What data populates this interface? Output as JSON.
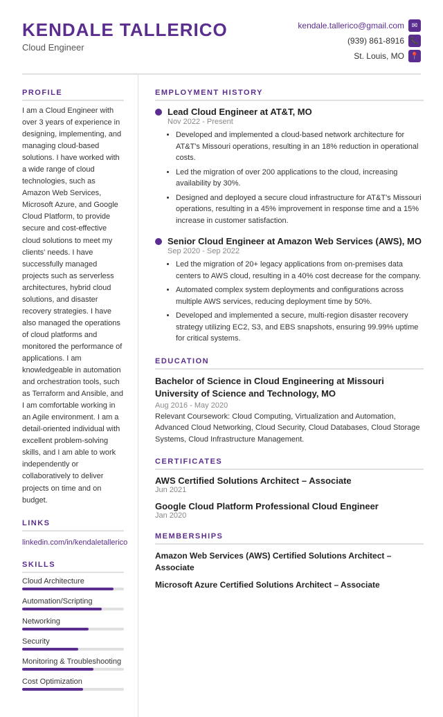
{
  "header": {
    "name": "KENDALE TALLERICO",
    "title": "Cloud Engineer",
    "email": "kendale.tallerico@gmail.com",
    "phone": "(939) 861-8916",
    "location": "St. Louis, MO"
  },
  "profile": {
    "section_title": "PROFILE",
    "text": "I am a Cloud Engineer with over 3 years of experience in designing, implementing, and managing cloud-based solutions. I have worked with a wide range of cloud technologies, such as Amazon Web Services, Microsoft Azure, and Google Cloud Platform, to provide secure and cost-effective cloud solutions to meet my clients' needs. I have successfully managed projects such as serverless architectures, hybrid cloud solutions, and disaster recovery strategies. I have also managed the operations of cloud platforms and monitored the performance of applications. I am knowledgeable in automation and orchestration tools, such as Terraform and Ansible, and I am comfortable working in an Agile environment. I am a detail-oriented individual with excellent problem-solving skills, and I am able to work independently or collaboratively to deliver projects on time and on budget."
  },
  "links": {
    "section_title": "LINKS",
    "linkedin": "linkedin.com/in/kendaletallerico"
  },
  "skills": {
    "section_title": "SKILLS",
    "items": [
      {
        "name": "Cloud Architecture",
        "pct": 90
      },
      {
        "name": "Automation/Scripting",
        "pct": 78
      },
      {
        "name": "Networking",
        "pct": 65
      },
      {
        "name": "Security",
        "pct": 55
      },
      {
        "name": "Monitoring & Troubleshooting",
        "pct": 70
      },
      {
        "name": "Cost Optimization",
        "pct": 60
      }
    ]
  },
  "employment": {
    "section_title": "EMPLOYMENT HISTORY",
    "jobs": [
      {
        "title": "Lead Cloud Engineer at AT&T, MO",
        "date": "Nov 2022 - Present",
        "bullets": [
          "Developed and implemented a cloud-based network architecture for AT&T's Missouri operations, resulting in an 18% reduction in operational costs.",
          "Led the migration of over 200 applications to the cloud, increasing availability by 30%.",
          "Designed and deployed a secure cloud infrastructure for AT&T's Missouri operations, resulting in a 45% improvement in response time and a 15% increase in customer satisfaction."
        ]
      },
      {
        "title": "Senior Cloud Engineer at Amazon Web Services (AWS), MO",
        "date": "Sep 2020 - Sep 2022",
        "bullets": [
          "Led the migration of 20+ legacy applications from on-premises data centers to AWS cloud, resulting in a 40% cost decrease for the company.",
          "Automated complex system deployments and configurations across multiple AWS services, reducing deployment time by 50%.",
          "Developed and implemented a secure, multi-region disaster recovery strategy utilizing EC2, S3, and EBS snapshots, ensuring 99.99% uptime for critical systems."
        ]
      }
    ]
  },
  "education": {
    "section_title": "EDUCATION",
    "degree": "Bachelor of Science in Cloud Engineering at Missouri University of Science and Technology, MO",
    "date": "Aug 2016 - May 2020",
    "coursework": "Relevant Coursework: Cloud Computing, Virtualization and Automation, Advanced Cloud Networking, Cloud Security, Cloud Databases, Cloud Storage Systems, Cloud Infrastructure Management."
  },
  "certificates": {
    "section_title": "CERTIFICATES",
    "items": [
      {
        "name": "AWS Certified Solutions Architect – Associate",
        "date": "Jun 2021"
      },
      {
        "name": "Google Cloud Platform Professional Cloud Engineer",
        "date": "Jan 2020"
      }
    ]
  },
  "memberships": {
    "section_title": "MEMBERSHIPS",
    "items": [
      {
        "name": "Amazon Web Services (AWS) Certified Solutions Architect – Associate"
      },
      {
        "name": "Microsoft Azure Certified Solutions Architect – Associate"
      }
    ]
  }
}
